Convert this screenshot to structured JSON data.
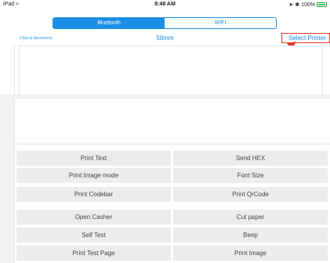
{
  "status": {
    "device": "iPad",
    "wifi_icon": "wifi-icon",
    "time": "8:48 AM",
    "battery": "100%"
  },
  "tabs": [
    {
      "label": "Bluetooth",
      "active": true
    },
    {
      "label": "WIFI",
      "active": false
    }
  ],
  "connection": {
    "disconnect_label": "Click to disconnect",
    "paper_size": "58mm",
    "select_printer_label": "Select Printer"
  },
  "buttons": {
    "print_text": "Print Text",
    "send_hex": "Send HEX",
    "print_image_mode": "Print Image mode",
    "font_size": "Font Size",
    "print_codebar": "Print Codebar",
    "print_qrcode": "Print QrCode",
    "open_casher": "Open Casher",
    "cut_paper": "Cut paper",
    "self_test": "Self Test",
    "beep": "Beep",
    "print_test_page": "Print Test Page",
    "print_image": "Print Image"
  },
  "colors": {
    "accent": "#1b8fe5",
    "annotation": "#e33a2a",
    "button_bg": "#ececec"
  }
}
